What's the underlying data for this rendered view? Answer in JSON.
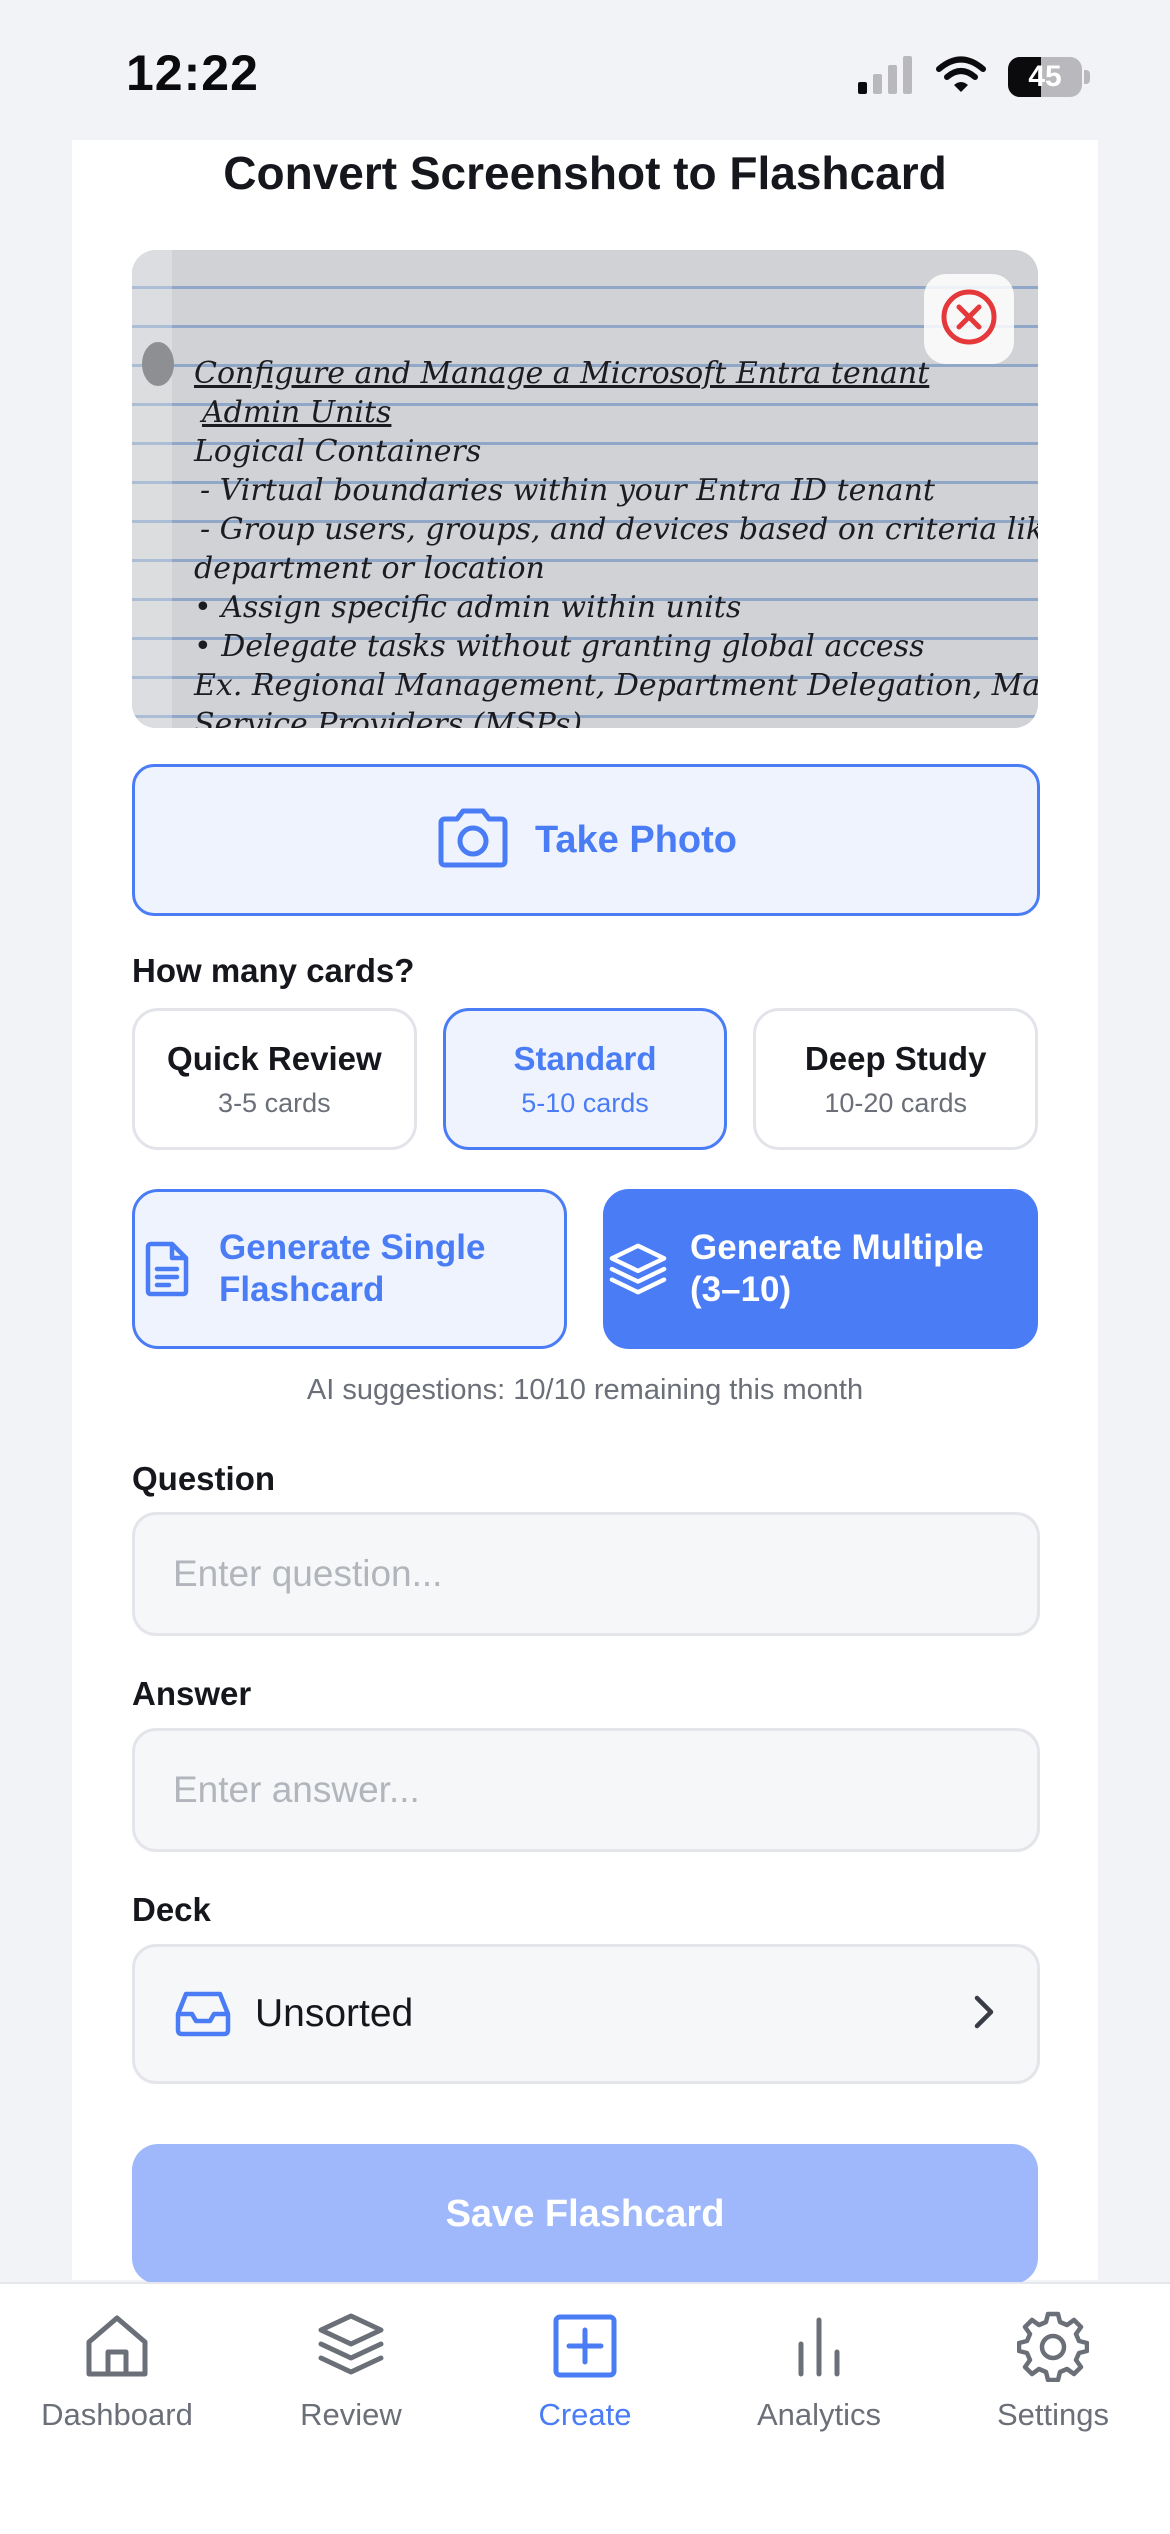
{
  "status_bar": {
    "time": "12:22",
    "battery": "45",
    "battery_level": 0.45
  },
  "page": {
    "title": "Convert Screenshot to Flashcard"
  },
  "photo": {
    "notes": [
      "Configure and Manage a Microsoft Entra tenant",
      "Admin Units",
      "Logical Containers",
      "- Virtual boundaries within your Entra ID tenant",
      "- Group users, groups, and devices based on criteria like",
      "department or location",
      "• Assign specific admin within units",
      "• Delegate tasks without granting global access",
      "Ex. Regional Management, Department Delegation, Managed",
      "Service Providers (MSPs)"
    ],
    "remove_icon": "close-circle-icon"
  },
  "take_photo": {
    "label": "Take Photo",
    "icon": "camera-icon"
  },
  "card_count": {
    "label": "How many cards?",
    "options": [
      {
        "title": "Quick Review",
        "sub": "3-5 cards",
        "selected": false
      },
      {
        "title": "Standard",
        "sub": "5-10 cards",
        "selected": true
      },
      {
        "title": "Deep Study",
        "sub": "10-20 cards",
        "selected": false
      }
    ]
  },
  "generate": {
    "single_label": "Generate Single Flashcard",
    "multiple_label": "Generate Multiple (3–10)"
  },
  "ai_note": "AI suggestions: 10/10 remaining this month",
  "question": {
    "label": "Question",
    "placeholder": "Enter question...",
    "value": ""
  },
  "answer": {
    "label": "Answer",
    "placeholder": "Enter answer...",
    "value": ""
  },
  "deck": {
    "label": "Deck",
    "value": "Unsorted",
    "icon": "inbox-icon"
  },
  "save": {
    "label": "Save Flashcard"
  },
  "tabs": [
    {
      "label": "Dashboard",
      "icon": "home-icon",
      "active": false
    },
    {
      "label": "Review",
      "icon": "layers-icon",
      "active": false
    },
    {
      "label": "Create",
      "icon": "plus-square-icon",
      "active": true
    },
    {
      "label": "Analytics",
      "icon": "bar-chart-icon",
      "active": false
    },
    {
      "label": "Settings",
      "icon": "gear-icon",
      "active": false
    }
  ],
  "colors": {
    "accent": "#4a7cf5",
    "accent_light": "#eef3fe",
    "save_disabled": "#9fb8fb",
    "danger": "#e5383b"
  }
}
